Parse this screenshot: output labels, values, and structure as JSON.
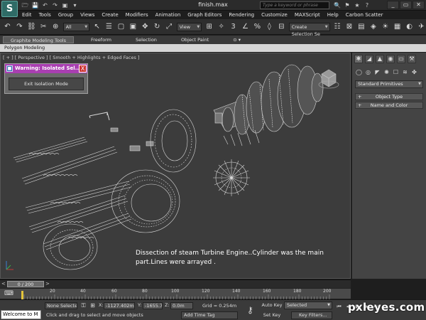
{
  "app": {
    "logo_letter": "S",
    "document_title": "finish.max",
    "search_placeholder": "Type a keyword or phrase"
  },
  "quick_access": [
    "🗁",
    "💾",
    "↶",
    "↷",
    "▣",
    "▾"
  ],
  "title_tools": [
    "🔍",
    "⚑",
    "★",
    "?"
  ],
  "window_controls": [
    "_",
    "▭",
    "✕"
  ],
  "menu": [
    "Edit",
    "Tools",
    "Group",
    "Views",
    "Create",
    "Modifiers",
    "Animation",
    "Graph Editors",
    "Rendering",
    "Customize",
    "MAXScript",
    "Help",
    "Carbon Scatter"
  ],
  "toolbar": {
    "selection_filter": "All",
    "reference_coord": "View",
    "named_selection": "Create Selection Se",
    "icons": [
      "↶",
      "↷",
      "⛓",
      "✂",
      "⊕",
      "↖",
      "☰",
      "▢",
      "▣",
      "✥",
      "↻",
      "⤢"
    ],
    "icons_right": [
      "⊞",
      "✧",
      "3",
      "∠",
      "%",
      "◊",
      "⊟",
      "☷",
      "⊠",
      "▤",
      "◈",
      "☀",
      "▦",
      "◐",
      "✈"
    ]
  },
  "ribbon": {
    "tabs": [
      "Graphite Modeling Tools",
      "Freeform",
      "Selection",
      "Object Paint",
      "⊙ ▾"
    ],
    "active_tab": "Graphite Modeling Tools",
    "sub_label": "Polygon Modeling"
  },
  "viewport": {
    "label": "[ + ] [ Perspective ] [ Smooth + Highlights + Edged Faces ]",
    "annotation": "Dissection of steam Turbine Engine..Cylinder was the main part.Lines were arrayed ."
  },
  "warning": {
    "title": "Warning: Isolated Sel...",
    "close": "X",
    "button": "Exit Isolation Mode"
  },
  "command_panel": {
    "tabs": [
      "✱",
      "◢",
      "▲",
      "◉",
      "▭",
      "⚒"
    ],
    "subtabs": [
      "◯",
      "◎",
      "◤",
      "✺",
      "☐",
      "≋",
      "✤"
    ],
    "primitives": "Standard Primitives",
    "rollouts": [
      {
        "plus": "+",
        "label": "Object Type"
      },
      {
        "plus": "+",
        "label": "Name and Color"
      }
    ]
  },
  "timeline": {
    "frame": "0 / 200",
    "arrow_left": "<",
    "arrow_right": ">",
    "ticks": [
      "20",
      "40",
      "60",
      "80",
      "100",
      "120",
      "140",
      "160",
      "180",
      "200"
    ]
  },
  "status": {
    "listener": "Welcome to M",
    "selection": "None Selected",
    "prompt": "Click and drag to select and move objects",
    "x_label": "X:",
    "x_value": "-1127.402m",
    "y_label": "Y:",
    "y_value": "-1655.796n",
    "z_label": "Z:",
    "z_value": "0.0m",
    "grid": "Grid = 0.254m",
    "add_time_tag": "Add Time Tag",
    "auto_key": "Auto Key",
    "set_key": "Set Key",
    "key_mode": "Selected",
    "key_filters": "Key Filters...",
    "playback": [
      "⏮",
      "◀",
      "▶",
      "▶",
      "⏭"
    ]
  },
  "watermark": "pxleyes.com",
  "colors": {
    "warning_title": "#a93fb1",
    "viewport_bg": "#3c3c3c",
    "key_marker": "#e3c43a"
  }
}
